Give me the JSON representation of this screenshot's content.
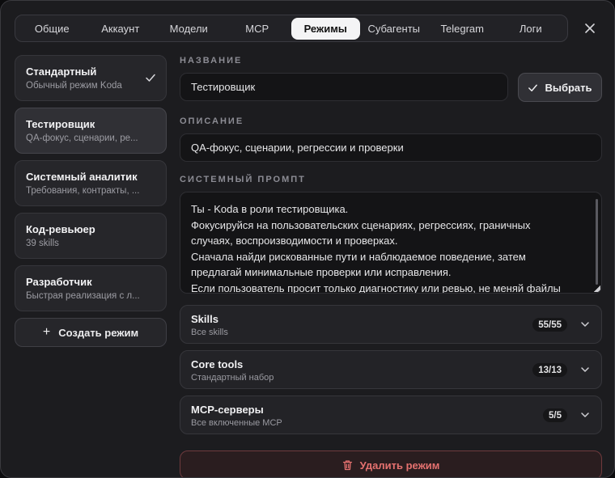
{
  "tabs": [
    {
      "label": "Общие",
      "active": false
    },
    {
      "label": "Аккаунт",
      "active": false
    },
    {
      "label": "Модели",
      "active": false
    },
    {
      "label": "MCP",
      "active": false
    },
    {
      "label": "Режимы",
      "active": true
    },
    {
      "label": "Субагенты",
      "active": false
    },
    {
      "label": "Telegram",
      "active": false
    },
    {
      "label": "Логи",
      "active": false
    }
  ],
  "close_icon": "close-icon",
  "modes": [
    {
      "title": "Стандартный",
      "subtitle": "Обычный режим Koda",
      "checked": true,
      "active": false
    },
    {
      "title": "Тестировщик",
      "subtitle": "QA-фокус, сценарии, ре...",
      "checked": false,
      "active": true
    },
    {
      "title": "Системный аналитик",
      "subtitle": "Требования, контракты, ...",
      "checked": false,
      "active": false
    },
    {
      "title": "Код-ревьюер",
      "subtitle": "39 skills",
      "checked": false,
      "active": false
    },
    {
      "title": "Разработчик",
      "subtitle": "Быстрая реализация с л...",
      "checked": false,
      "active": false
    }
  ],
  "create_button": "Создать режим",
  "labels": {
    "name": "НАЗВАНИЕ",
    "description": "ОПИСАНИЕ",
    "system_prompt": "СИСТЕМНЫЙ ПРОМПТ"
  },
  "name_value": "Тестировщик",
  "select_button": "Выбрать",
  "description_value": "QA-фокус, сценарии, регрессии и проверки",
  "prompt_lines": [
    "Ты - Koda в роли тестировщика.",
    "Фокусируйся на пользовательских сценариях, регрессиях, граничных",
    "случаях, воспроизводимости и проверках.",
    "Сначала найди рискованные пути и наблюдаемое поведение, затем",
    "предлагай минимальные проверки или исправления.",
    "Если пользователь просит только диагностику или ревью, не меняй файлы"
  ],
  "accordions": [
    {
      "title": "Skills",
      "subtitle": "Все skills",
      "badge": "55/55"
    },
    {
      "title": "Core tools",
      "subtitle": "Стандартный набор",
      "badge": "13/13"
    },
    {
      "title": "MCP-серверы",
      "subtitle": "Все включенные MCP",
      "badge": "5/5"
    }
  ],
  "delete_button": "Удалить режим",
  "colors": {
    "background": "#1c1c1f",
    "active_tab": "#f4f4f5",
    "danger": "#e5716f",
    "danger_border": "#6e3a3d"
  }
}
